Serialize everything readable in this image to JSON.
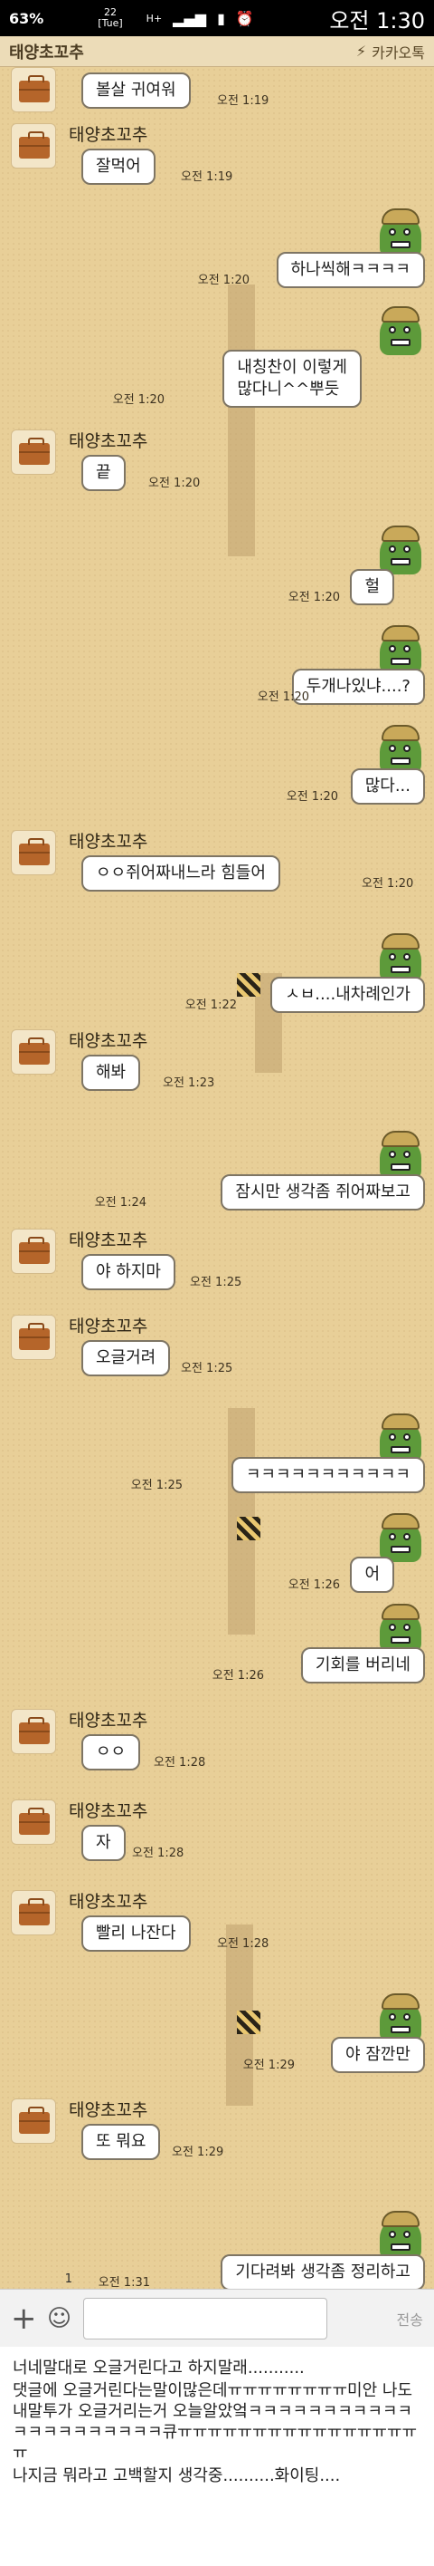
{
  "status_bar": {
    "battery": "63%",
    "date_day": "22",
    "date_weekday": "[Tue]",
    "network": "H+",
    "clock": "오전 1:30"
  },
  "title_bar": {
    "room_title": "태양초꼬추",
    "app_name": "카카오톡"
  },
  "messages": [
    {
      "side": "left",
      "show_sender": false,
      "sender": "",
      "text": "볼살 귀여워",
      "time": "오전 1:19"
    },
    {
      "side": "left",
      "show_sender": true,
      "sender": "태양초꼬추",
      "text": "잘먹어",
      "time": "오전 1:19"
    },
    {
      "side": "right",
      "text": "하나씩해ㅋㅋㅋㅋ",
      "time": "오전 1:20"
    },
    {
      "side": "right",
      "text": "내칭찬이 이렇게\n많다니^^뿌듯",
      "time": "오전 1:20"
    },
    {
      "side": "left",
      "show_sender": true,
      "sender": "태양초꼬추",
      "text": "끝",
      "time": "오전 1:20"
    },
    {
      "side": "right",
      "text": "헐",
      "time": "오전 1:20"
    },
    {
      "side": "right",
      "text": "두개나있냐....?",
      "time": "오전 1:20"
    },
    {
      "side": "right",
      "text": "많다...",
      "time": "오전 1:20"
    },
    {
      "side": "left",
      "show_sender": true,
      "sender": "태양초꼬추",
      "text": "ㅇㅇ쥐어짜내느라 힘들어",
      "time": "오전 1:20"
    },
    {
      "side": "right",
      "text": "ㅅㅂ....내차례인가",
      "time": "오전 1:22"
    },
    {
      "side": "left",
      "show_sender": true,
      "sender": "태양초꼬추",
      "text": "해봐",
      "time": "오전 1:23"
    },
    {
      "side": "right",
      "text": "잠시만 생각좀 쥐어짜보고",
      "time": "오전 1:24"
    },
    {
      "side": "left",
      "show_sender": true,
      "sender": "태양초꼬추",
      "text": "야 하지마",
      "time": "오전 1:25"
    },
    {
      "side": "left",
      "show_sender": true,
      "sender": "태양초꼬추",
      "text": "오글거려",
      "time": "오전 1:25"
    },
    {
      "side": "right",
      "text": "ㅋㅋㅋㅋㅋㅋㅋㅋㅋㅋㅋ",
      "time": "오전 1:25"
    },
    {
      "side": "right",
      "text": "어",
      "time": "오전 1:26"
    },
    {
      "side": "right",
      "text": "기회를 버리네",
      "time": "오전 1:26"
    },
    {
      "side": "left",
      "show_sender": true,
      "sender": "태양초꼬추",
      "text": "ㅇㅇ",
      "time": "오전 1:28"
    },
    {
      "side": "left",
      "show_sender": true,
      "sender": "태양초꼬추",
      "text": "자",
      "time": "오전 1:28"
    },
    {
      "side": "left",
      "show_sender": true,
      "sender": "태양초꼬추",
      "text": "빨리 나잔다",
      "time": "오전 1:28"
    },
    {
      "side": "right",
      "text": "야 잠깐만",
      "time": "오전 1:29"
    },
    {
      "side": "left",
      "show_sender": true,
      "sender": "태양초꼬추",
      "text": "또 뭐요",
      "time": "오전 1:29"
    },
    {
      "side": "right",
      "text": "기다려봐 생각좀 정리하고",
      "time": "오전 1:31",
      "unread": "1"
    }
  ],
  "input_bar": {
    "send_label": "전송"
  },
  "caption": {
    "lines": [
      "너네말대로 오글거린다고 하지말래...........",
      "댓글에 오글거린다는말이많은데ㅠㅠㅠㅠㅠㅠㅠㅠ미안 나도 내말투가 오글거리는거 오늘알았엌ㅋㅋㅋㅋㅋㅋㅋㅋㅋㅋㅋㅋㅋㅋㅋㅋㅋㅋㅋㅋㅋ큐ㅠㅠㅠㅠㅠㅠㅠㅠㅠㅠㅠㅠㅠㅠㅠㅠㅠ",
      "나지금 뭐라고 고백할지 생각중..........화이팅...."
    ]
  }
}
